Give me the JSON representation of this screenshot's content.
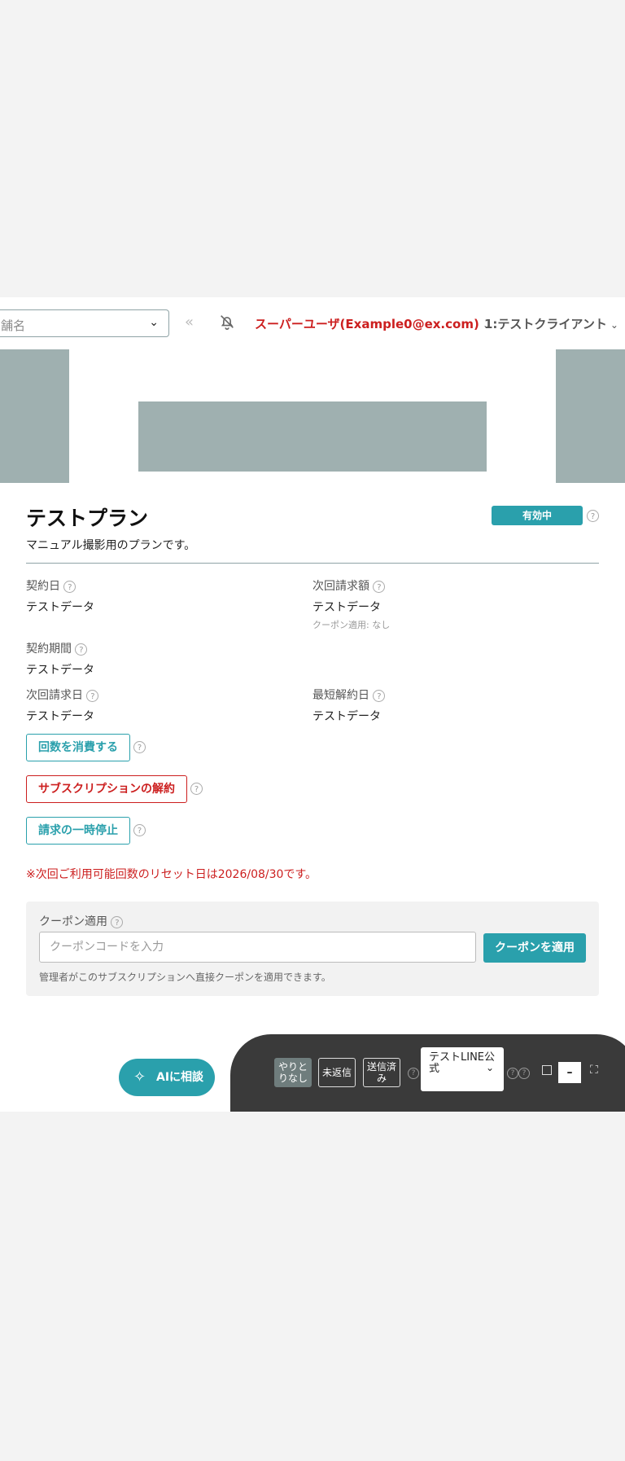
{
  "header": {
    "store_placeholder": "舗名",
    "user_label": "スーパーユーザ(Example0@ex.com)",
    "client_label": "1:テストクライアント"
  },
  "plan": {
    "title": "テストプラン",
    "status": "有効中",
    "description": "マニュアル撮影用のプランです。",
    "fields": {
      "contract_date": {
        "label": "契約日",
        "value": "テストデータ"
      },
      "next_amount": {
        "label": "次回請求額",
        "value": "テストデータ",
        "sub": "クーポン適用: なし"
      },
      "contract_period": {
        "label": "契約期間",
        "value": "テストデータ"
      },
      "next_billing_date": {
        "label": "次回請求日",
        "value": "テストデータ"
      },
      "min_cancel_date": {
        "label": "最短解約日",
        "value": "テストデータ"
      }
    },
    "actions": {
      "consume": "回数を消費する",
      "cancel": "サブスクリプションの解約",
      "pause": "請求の一時停止"
    },
    "reset_note": "※次回ご利用可能回数のリセット日は2026/08/30です。"
  },
  "coupon": {
    "label": "クーポン適用",
    "placeholder": "クーポンコードを入力",
    "apply": "クーポンを適用",
    "hint": "管理者がこのサブスクリプションへ直接クーポンを適用できます。"
  },
  "ai": {
    "label": "AIに相談"
  },
  "chat_bar": {
    "filters": [
      "やりとりなし",
      "未返信",
      "送信済み"
    ],
    "account": "テストLINE公式",
    "minimize": "–"
  },
  "colors": {
    "accent": "#2aa0ac",
    "danger": "#cc1f1f",
    "placeholder_gray": "#9fb0b0",
    "chat_bg": "#3a3a3a"
  }
}
